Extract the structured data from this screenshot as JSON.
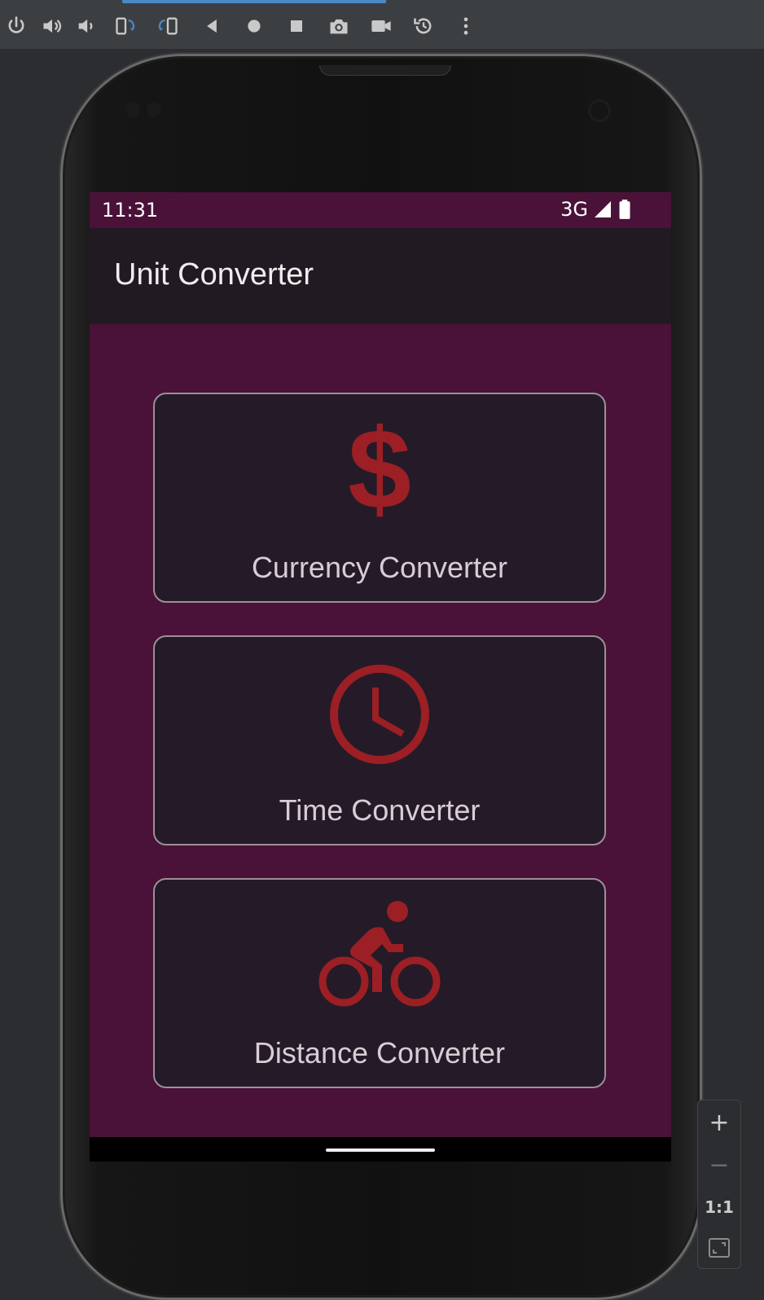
{
  "toolbar": {
    "buttons": [
      {
        "name": "power-icon"
      },
      {
        "name": "volume-up-icon"
      },
      {
        "name": "volume-down-icon"
      },
      {
        "name": "rotate-left-icon"
      },
      {
        "name": "rotate-right-icon"
      },
      {
        "name": "back-icon"
      },
      {
        "name": "home-icon"
      },
      {
        "name": "overview-icon"
      },
      {
        "name": "camera-icon"
      },
      {
        "name": "video-camera-icon"
      },
      {
        "name": "snapshot-icon"
      },
      {
        "name": "more-icon"
      }
    ]
  },
  "status_bar": {
    "time": "11:31",
    "network": "3G"
  },
  "app_bar": {
    "title": "Unit Converter"
  },
  "cards": [
    {
      "label": "Currency Converter",
      "icon": "dollar-icon"
    },
    {
      "label": "Time Converter",
      "icon": "clock-icon"
    },
    {
      "label": "Distance Converter",
      "icon": "bicycle-icon"
    }
  ],
  "zoom": {
    "plus": "+",
    "minus": "−",
    "one_to_one": "1:1"
  },
  "colors": {
    "accent_icon": "#9b1f24",
    "screen_background": "#4a1238",
    "card_background": "#251a28",
    "app_bar_background": "#221a22",
    "card_text": "#d8cdd5"
  }
}
